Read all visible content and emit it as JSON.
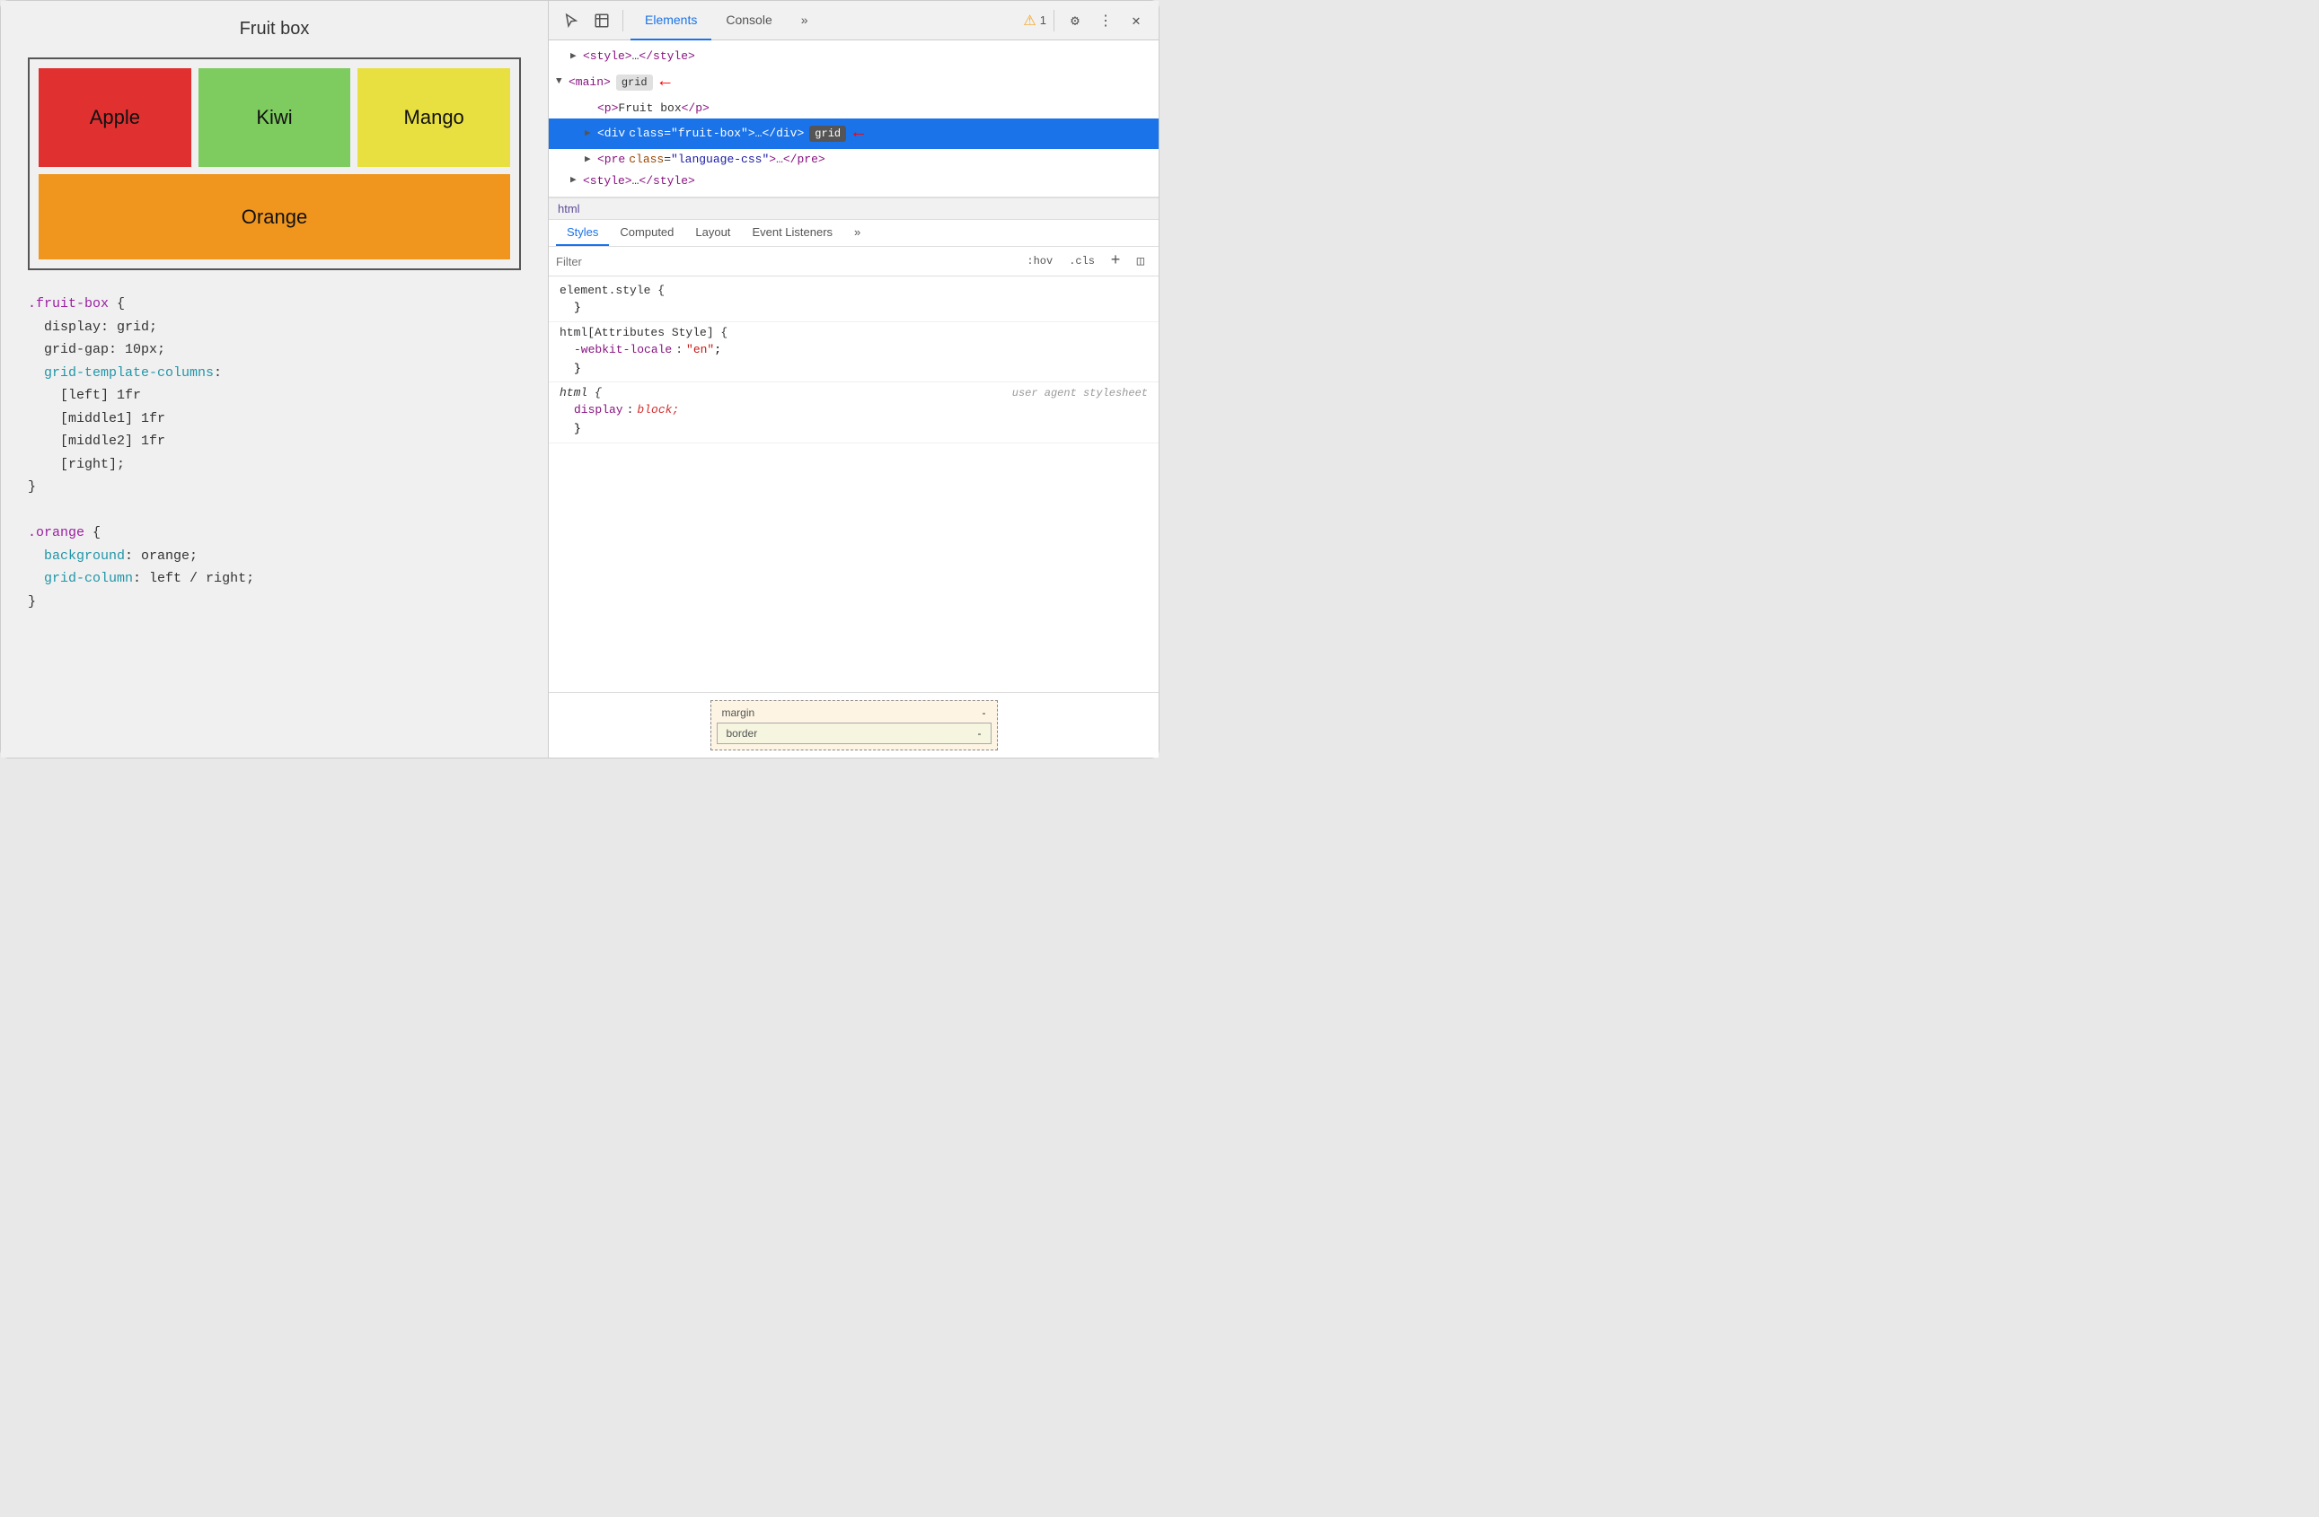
{
  "left": {
    "title": "Fruit box",
    "fruits": [
      {
        "name": "Apple",
        "class": "apple"
      },
      {
        "name": "Kiwi",
        "class": "kiwi"
      },
      {
        "name": "Mango",
        "class": "mango"
      },
      {
        "name": "Orange",
        "class": "orange"
      }
    ],
    "code_blocks": [
      {
        "lines": [
          {
            "type": "selector",
            "text": ".fruit-box"
          },
          {
            "type": "brace-open",
            "text": " {"
          },
          {
            "type": "prop",
            "prop": "  display",
            "value": " grid;"
          },
          {
            "type": "prop",
            "prop": "  grid-gap",
            "value": " 10px;"
          },
          {
            "type": "prop-name-only",
            "text": "  grid-template-columns"
          },
          {
            "type": "value-only",
            "text": "    [left] 1fr"
          },
          {
            "type": "value-only",
            "text": "    [middle1] 1fr"
          },
          {
            "type": "value-only",
            "text": "    [middle2] 1fr"
          },
          {
            "type": "value-only",
            "text": "    [right];"
          },
          {
            "type": "brace-close",
            "text": "}"
          }
        ]
      },
      {
        "lines": [
          {
            "type": "selector",
            "text": ".orange"
          },
          {
            "type": "brace-open",
            "text": " {"
          },
          {
            "type": "prop",
            "prop": "  background",
            "value": " orange;"
          },
          {
            "type": "prop",
            "prop": "  grid-column",
            "value": " left / right;"
          },
          {
            "type": "brace-close",
            "text": "}"
          }
        ]
      }
    ]
  },
  "devtools": {
    "toolbar": {
      "tabs": [
        "Elements",
        "Console",
        ">>"
      ],
      "active_tab": "Elements",
      "warning_count": "1",
      "icons": {
        "cursor": "⬡",
        "box": "⬜",
        "more": "⋮",
        "close": "✕",
        "gear": "⚙"
      }
    },
    "dom": {
      "lines": [
        {
          "indent": 4,
          "expanded": false,
          "content": "&lt;style&gt;…&lt;/style&gt;",
          "selected": false,
          "badge": null,
          "arrow": false
        },
        {
          "indent": 2,
          "expanded": true,
          "content": "&lt;main&gt;",
          "selected": false,
          "badge": "grid",
          "arrow": true
        },
        {
          "indent": 8,
          "expanded": false,
          "content": "&lt;p&gt;Fruit box&lt;/p&gt;",
          "selected": false,
          "badge": null,
          "arrow": false
        },
        {
          "indent": 8,
          "expanded": false,
          "content": "&lt;div class=\"fruit-box\"&gt;…&lt;/div&gt;",
          "selected": true,
          "badge": "grid",
          "arrow": true
        },
        {
          "indent": 8,
          "expanded": false,
          "content": "&lt;pre class=\"language-css\"&gt;…&lt;/pre&gt;",
          "selected": false,
          "badge": null,
          "arrow": false
        },
        {
          "indent": 4,
          "expanded": false,
          "content": "&lt;style&gt;…&lt;/style&gt;",
          "selected": false,
          "badge": null,
          "arrow": false
        }
      ]
    },
    "breadcrumb": "html",
    "styles_tabs": [
      "Styles",
      "Computed",
      "Layout",
      "Event Listeners",
      ">>"
    ],
    "active_styles_tab": "Styles",
    "filter": {
      "placeholder": "Filter",
      "hov_label": ":hov",
      "cls_label": ".cls"
    },
    "style_rules": [
      {
        "selector": "element.style {",
        "italic": false,
        "props": [
          {
            "name": null,
            "value": "}"
          }
        ],
        "right_label": null
      },
      {
        "selector": "html[Attributes Style] {",
        "italic": false,
        "props": [
          {
            "name": "-webkit-locale",
            "colon": ":",
            "value": "\"en\"",
            "value_class": "string"
          },
          {
            "name": null,
            "value": "}"
          }
        ],
        "right_label": null
      },
      {
        "selector": "html {",
        "italic": true,
        "props": [
          {
            "name": "display",
            "colon": ":",
            "value": "block;",
            "value_class": "red"
          },
          {
            "name": null,
            "value": "}"
          }
        ],
        "right_label": "user agent stylesheet"
      }
    ],
    "box_model": {
      "rows": [
        {
          "label": "margin",
          "value": "-"
        },
        {
          "label": "border",
          "value": "-"
        }
      ]
    }
  }
}
